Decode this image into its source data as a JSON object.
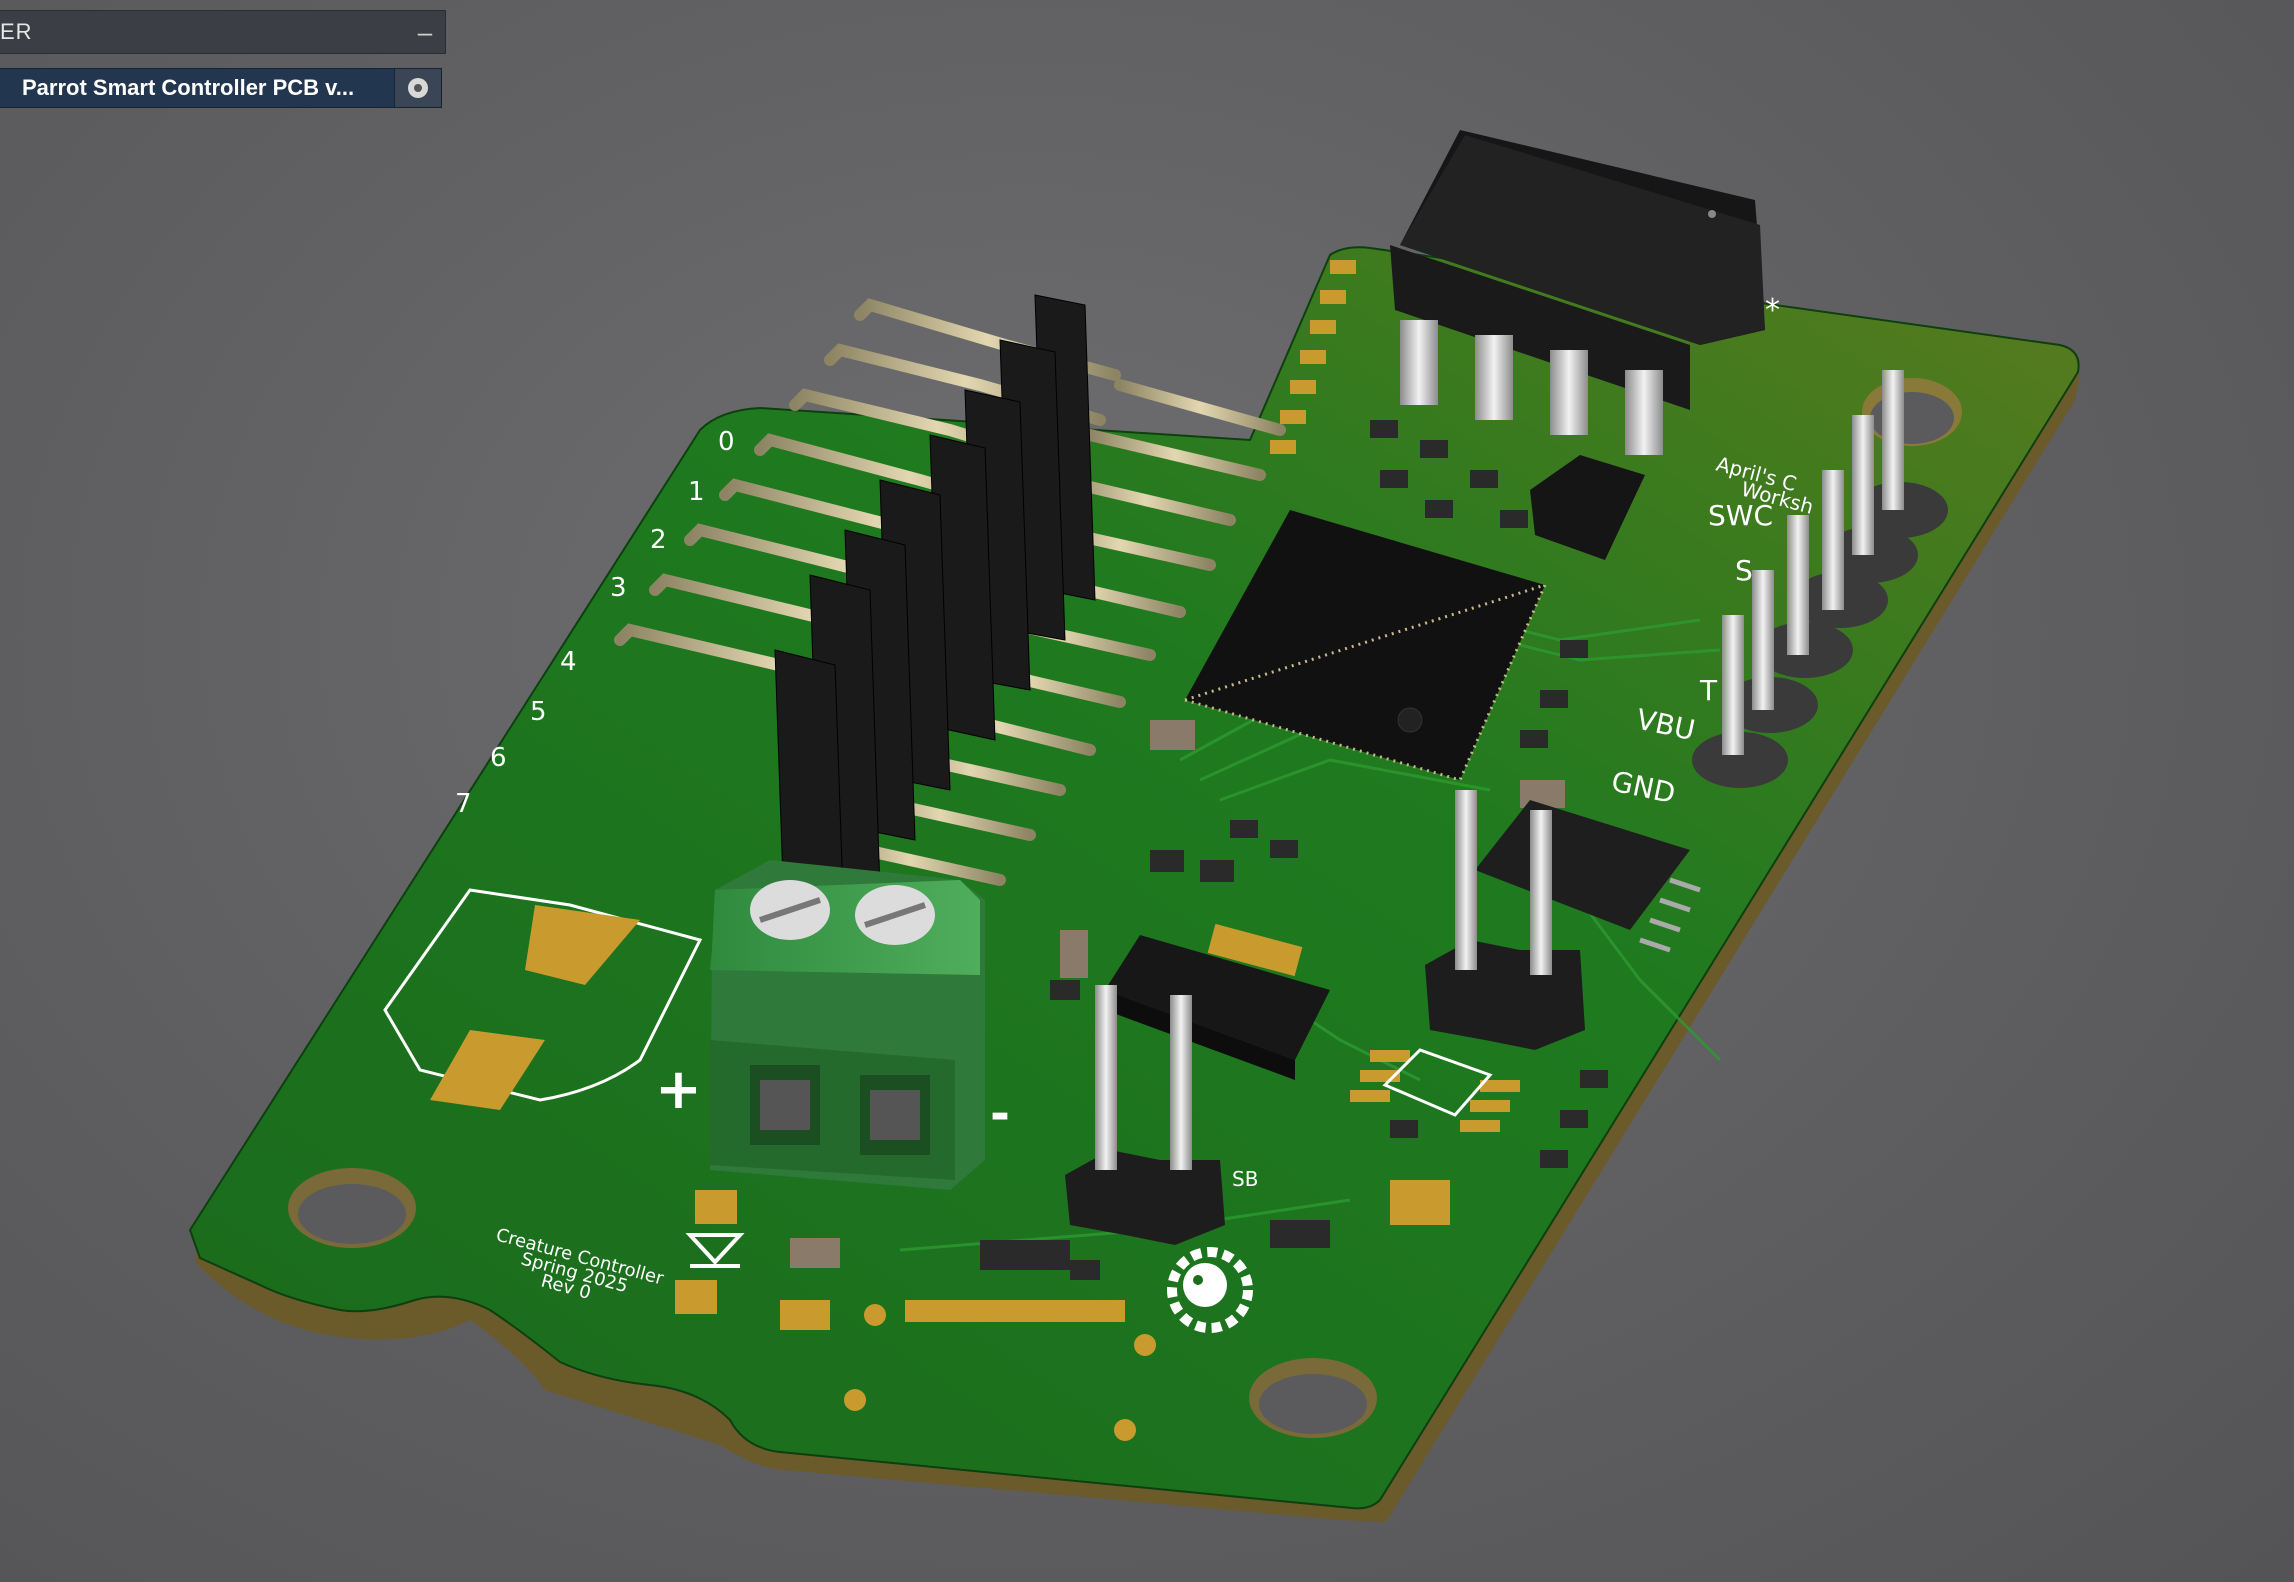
{
  "browser": {
    "title": "ER",
    "collapse_icon": "minus-icon",
    "document_name": "Parrot Smart Controller PCB v...",
    "visibility_icon": "radio-dot-icon"
  },
  "board": {
    "pin_labels": [
      "0",
      "1",
      "2",
      "3",
      "4",
      "5",
      "6",
      "7"
    ],
    "header_labels": [
      "SWC",
      "S",
      "T",
      "VBU",
      "GND"
    ],
    "credit_top": "April's C",
    "credit_bottom": "Worksh",
    "plus_label": "+",
    "minus_label": "-",
    "usb_label": "SB",
    "title_line1": "Creature Controller",
    "title_line2": "Spring 2025",
    "title_line3": "Rev 0",
    "asterisk": "*",
    "colors": {
      "pcb": "#1c6e1c",
      "pcb_dark": "#0f4810",
      "copper": "#c99a2e",
      "terminal": "#3e9a4c",
      "silkscreen": "#ffffff",
      "pin_gold": "#c8b98a"
    }
  }
}
